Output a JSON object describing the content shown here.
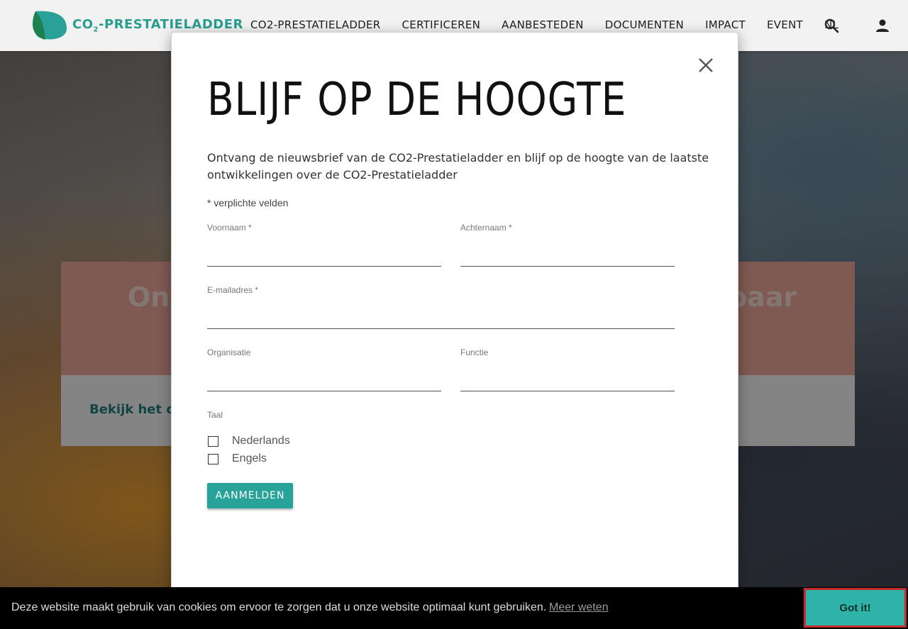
{
  "header": {
    "logo_text": "CO",
    "logo_sub": "2",
    "logo_text_rest": "-PRESTATIELADDER",
    "nav": [
      "CO2-PRESTATIELADDER",
      "CERTIFICEREN",
      "AANBESTEDEN",
      "DOCUMENTEN",
      "IMPACT",
      "EVENT",
      "NL"
    ],
    "search_icon": "search-icon",
    "user_icon": "user-icon"
  },
  "hero": {
    "block_title_left": "Ond",
    "block_title_right": "baar",
    "link_text": "Bekijk het ond"
  },
  "modal": {
    "title": "BLIJF OP DE HOOGTE",
    "intro": "Ontvang de nieuwsbrief van de CO2-Prestatieladder en blijf op de hoogte van de laatste ontwikkelingen over de CO2-Prestatieladder",
    "required_note": "* verplichte velden",
    "fields": {
      "first_name": "Voornaam *",
      "last_name": "Achternaam *",
      "email": "E-mailadres *",
      "organization": "Organisatie",
      "role": "Functie",
      "language": "Taal"
    },
    "languages": [
      "Nederlands",
      "Engels"
    ],
    "submit_label": "AANMELDEN",
    "close_icon": "close-icon"
  },
  "cookie": {
    "text": "Deze website maakt gebruik van cookies om ervoor te zorgen dat u onze website optimaal kunt gebruiken.",
    "link": "Meer weten",
    "button": "Got it!"
  },
  "colors": {
    "accent": "#27a39a",
    "brand_green": "#2a9d8f",
    "cookie_button": "#2fb3a8",
    "highlight_border": "#c42b2b"
  }
}
